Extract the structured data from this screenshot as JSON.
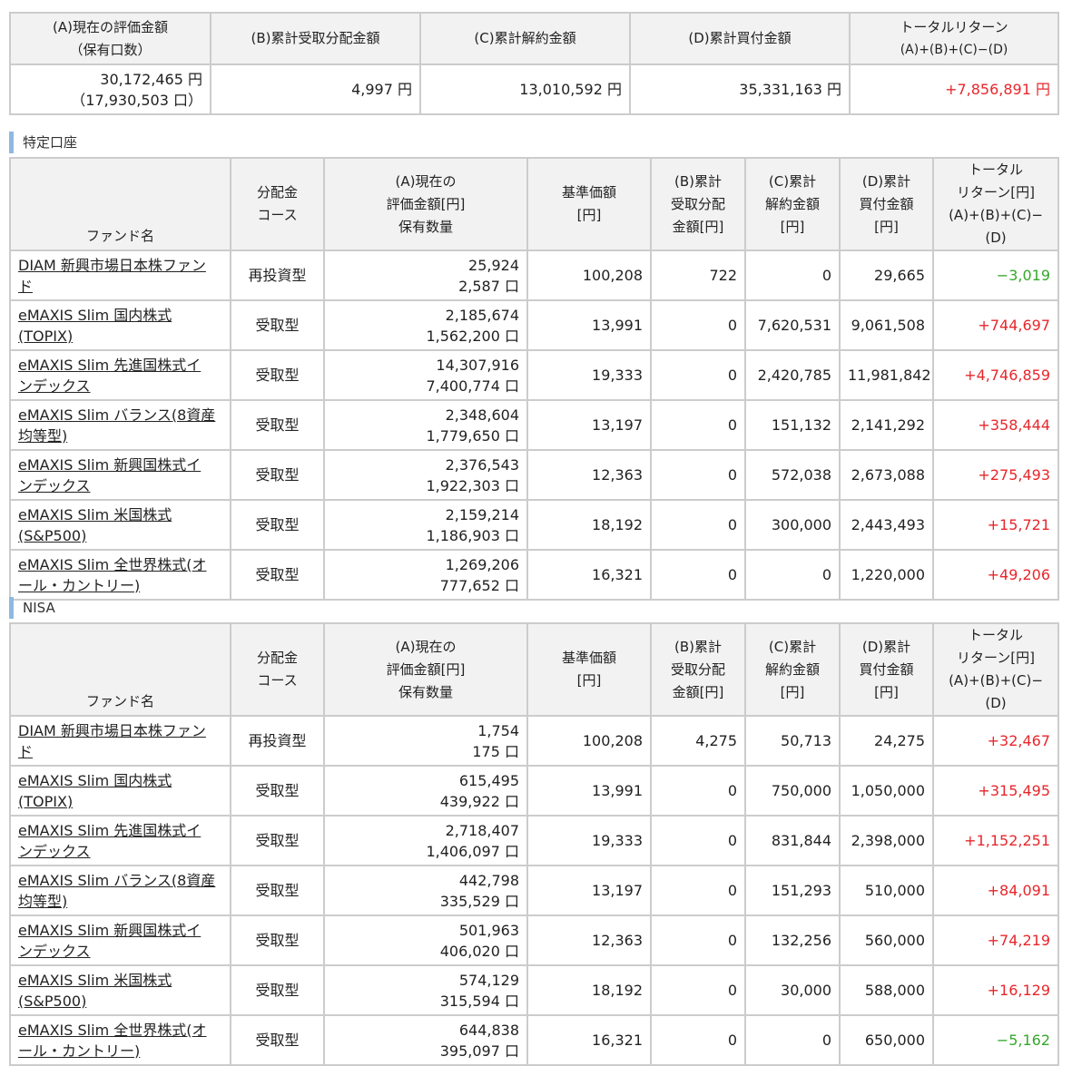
{
  "summary": {
    "headers": {
      "a_line1": "(A)現在の評価金額",
      "a_line2": "（保有口数）",
      "b": "(B)累計受取分配金額",
      "c": "(C)累計解約金額",
      "d": "(D)累計買付金額",
      "total_line1": "トータルリターン",
      "total_line2": "(A)+(B)+(C)−(D)"
    },
    "values": {
      "a": "30,172,465 円",
      "a_units": "（17,930,503 口）",
      "b": "4,997 円",
      "c": "13,010,592 円",
      "d": "35,331,163 円",
      "total": "+7,856,891 円"
    }
  },
  "columns": {
    "fund_name": "ファンド名",
    "course_1": "分配金",
    "course_2": "コース",
    "a_1": "(A)現在の",
    "a_2": "評価金額[円]",
    "a_3": "保有数量",
    "nav_1": "基準価額",
    "nav_2": "[円]",
    "b_1": "(B)累計",
    "b_2": "受取分配",
    "b_3": "金額[円]",
    "c_1": "(C)累計",
    "c_2": "解約金額",
    "c_3": "[円]",
    "d_1": "(D)累計",
    "d_2": "買付金額",
    "d_3": "[円]",
    "ret_1": "トータル",
    "ret_2": "リターン[円]",
    "ret_3": "(A)+(B)+(C)−(D)"
  },
  "sections": [
    {
      "label": "特定口座",
      "rows": [
        {
          "name1": "DIAM 新興市場日本株ファン",
          "name2": "ド",
          "course": "再投資型",
          "value": "25,924",
          "units": "2,587 口",
          "nav": "100,208",
          "b": "722",
          "c": "0",
          "d": "29,665",
          "ret": "−3,019",
          "sign": "neg"
        },
        {
          "name1": "eMAXIS Slim 国内株式",
          "name2": "(TOPIX)",
          "course": "受取型",
          "value": "2,185,674",
          "units": "1,562,200 口",
          "nav": "13,991",
          "b": "0",
          "c": "7,620,531",
          "d": "9,061,508",
          "ret": "+744,697",
          "sign": "pos"
        },
        {
          "name1": "eMAXIS Slim 先進国株式イ",
          "name2": "ンデックス",
          "course": "受取型",
          "value": "14,307,916",
          "units": "7,400,774 口",
          "nav": "19,333",
          "b": "0",
          "c": "2,420,785",
          "d": "11,981,842",
          "ret": "+4,746,859",
          "sign": "pos"
        },
        {
          "name1": "eMAXIS Slim バランス(8資産",
          "name2": "均等型)",
          "course": "受取型",
          "value": "2,348,604",
          "units": "1,779,650 口",
          "nav": "13,197",
          "b": "0",
          "c": "151,132",
          "d": "2,141,292",
          "ret": "+358,444",
          "sign": "pos"
        },
        {
          "name1": "eMAXIS Slim 新興国株式イ",
          "name2": "ンデックス",
          "course": "受取型",
          "value": "2,376,543",
          "units": "1,922,303 口",
          "nav": "12,363",
          "b": "0",
          "c": "572,038",
          "d": "2,673,088",
          "ret": "+275,493",
          "sign": "pos"
        },
        {
          "name1": "eMAXIS Slim 米国株式",
          "name2": "(S&P500)",
          "course": "受取型",
          "value": "2,159,214",
          "units": "1,186,903 口",
          "nav": "18,192",
          "b": "0",
          "c": "300,000",
          "d": "2,443,493",
          "ret": "+15,721",
          "sign": "pos"
        },
        {
          "name1": "eMAXIS Slim 全世界株式(オ",
          "name2": "ール・カントリー)",
          "course": "受取型",
          "value": "1,269,206",
          "units": "777,652 口",
          "nav": "16,321",
          "b": "0",
          "c": "0",
          "d": "1,220,000",
          "ret": "+49,206",
          "sign": "pos"
        }
      ]
    },
    {
      "label": "NISA",
      "rows": [
        {
          "name1": "DIAM 新興市場日本株ファン",
          "name2": "ド",
          "course": "再投資型",
          "value": "1,754",
          "units": "175 口",
          "nav": "100,208",
          "b": "4,275",
          "c": "50,713",
          "d": "24,275",
          "ret": "+32,467",
          "sign": "pos"
        },
        {
          "name1": "eMAXIS Slim 国内株式",
          "name2": "(TOPIX)",
          "course": "受取型",
          "value": "615,495",
          "units": "439,922 口",
          "nav": "13,991",
          "b": "0",
          "c": "750,000",
          "d": "1,050,000",
          "ret": "+315,495",
          "sign": "pos"
        },
        {
          "name1": "eMAXIS Slim 先進国株式イ",
          "name2": "ンデックス",
          "course": "受取型",
          "value": "2,718,407",
          "units": "1,406,097 口",
          "nav": "19,333",
          "b": "0",
          "c": "831,844",
          "d": "2,398,000",
          "ret": "+1,152,251",
          "sign": "pos"
        },
        {
          "name1": "eMAXIS Slim バランス(8資産",
          "name2": "均等型)",
          "course": "受取型",
          "value": "442,798",
          "units": "335,529 口",
          "nav": "13,197",
          "b": "0",
          "c": "151,293",
          "d": "510,000",
          "ret": "+84,091",
          "sign": "pos"
        },
        {
          "name1": "eMAXIS Slim 新興国株式イ",
          "name2": "ンデックス",
          "course": "受取型",
          "value": "501,963",
          "units": "406,020 口",
          "nav": "12,363",
          "b": "0",
          "c": "132,256",
          "d": "560,000",
          "ret": "+74,219",
          "sign": "pos"
        },
        {
          "name1": "eMAXIS Slim 米国株式",
          "name2": "(S&P500)",
          "course": "受取型",
          "value": "574,129",
          "units": "315,594 口",
          "nav": "18,192",
          "b": "0",
          "c": "30,000",
          "d": "588,000",
          "ret": "+16,129",
          "sign": "pos"
        },
        {
          "name1": "eMAXIS Slim 全世界株式(オ",
          "name2": "ール・カントリー)",
          "course": "受取型",
          "value": "644,838",
          "units": "395,097 口",
          "nav": "16,321",
          "b": "0",
          "c": "0",
          "d": "650,000",
          "ret": "−5,162",
          "sign": "neg"
        }
      ]
    }
  ]
}
